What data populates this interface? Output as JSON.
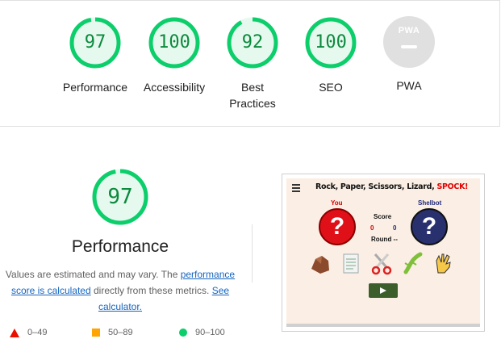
{
  "categories": [
    {
      "label": "Performance",
      "score": "97",
      "color": "#0cce6b"
    },
    {
      "label": "Accessibility",
      "score": "100",
      "color": "#0cce6b"
    },
    {
      "label": "Best\nPractices",
      "score": "92",
      "color": "#0cce6b"
    },
    {
      "label": "SEO",
      "score": "100",
      "color": "#0cce6b"
    },
    {
      "label": "PWA",
      "badge_text": "PWA"
    }
  ],
  "performance": {
    "score": "97",
    "title": "Performance",
    "desc_prefix": "Values are estimated and may vary. The ",
    "desc_link1": "performance score is calculated",
    "desc_middle": " directly from these metrics. ",
    "desc_link2": "See calculator."
  },
  "legend": {
    "fail": "0–49",
    "average": "50–89",
    "pass": "90–100"
  },
  "screenshot": {
    "title": "Rock, Paper, Scissors, Lizard, ",
    "title_highlight": "SPOCK!",
    "you_label": "You",
    "bot_label": "Shelbot",
    "player_symbol": "?",
    "bot_symbol": "?",
    "score_label": "Score",
    "player_score": "0",
    "bot_score": "0",
    "round_label": "Round --"
  },
  "colors": {
    "pass": "#0cce6b",
    "pass_text": "#0c8a3e",
    "average": "#ffa400",
    "fail": "#eb0f00",
    "link": "#1565c0",
    "pwa_gray": "#e0e0e0"
  }
}
